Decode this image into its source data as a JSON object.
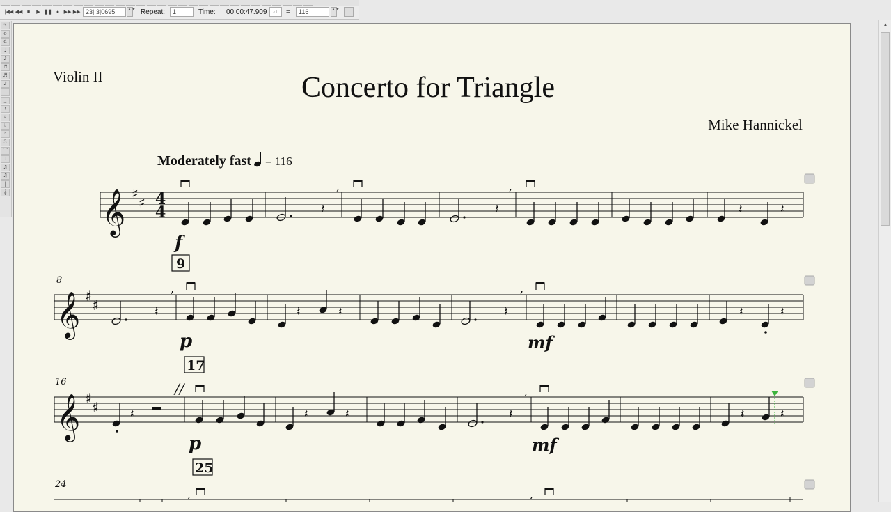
{
  "toolbar": {
    "measure_value": "23| 3|0695",
    "repeat_label": "Repeat:",
    "repeat_value": "1",
    "time_label": "Time:",
    "time_value": "00:00:47.909",
    "equals": "=",
    "tempo_value": "116"
  },
  "score": {
    "part_name": "Violin II",
    "title": "Concerto for Triangle",
    "composer": "Mike Hannickel",
    "tempo_text": "Moderately fast",
    "tempo_eq": "= 116",
    "time_signature": [
      "4",
      "4"
    ],
    "systems": [
      {
        "measure_number": "",
        "dynamics": [
          "f"
        ],
        "rehearsal_mark": "9"
      },
      {
        "measure_number": "8",
        "dynamics": [
          "p",
          "mf"
        ],
        "rehearsal_mark": "17"
      },
      {
        "measure_number": "16",
        "dynamics": [
          "p",
          "mf"
        ],
        "rehearsal_mark": "25",
        "caesura": "//"
      },
      {
        "measure_number": "24",
        "dynamics": [],
        "rehearsal_mark": ""
      }
    ]
  },
  "colors": {
    "page": "#f7f6ea",
    "ink": "#111111",
    "playback_cursor": "#3cb43c"
  }
}
